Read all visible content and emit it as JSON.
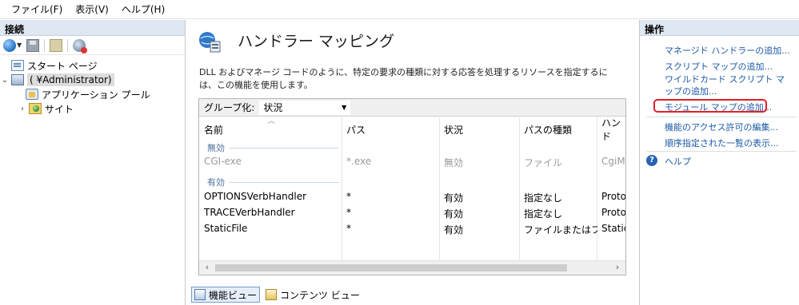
{
  "menu": [
    "ファイル(F)",
    "表示(V)",
    "ヘルプ(H)"
  ],
  "connections": {
    "title": "接続",
    "tree": [
      {
        "label": "スタート ページ"
      },
      {
        "label": "(        ¥Administrator)"
      },
      {
        "label": "アプリケーション プール"
      },
      {
        "label": "サイト"
      }
    ]
  },
  "center": {
    "title": "ハンドラー マッピング",
    "description": "DLL およびマネージ コードのように、特定の要求の種類に対する応答を処理するリソースを指定するには、この機能を使用します。",
    "group_label": "グループ化:",
    "group_value": "状況",
    "columns": [
      "名前",
      "パス",
      "状況",
      "パスの種類",
      "ハンド"
    ],
    "groups": [
      {
        "label": "無効",
        "rows": [
          [
            "CGI-exe",
            "*.exe",
            "無効",
            "ファイル",
            "CgiM"
          ]
        ]
      },
      {
        "label": "有効",
        "rows": [
          [
            "OPTIONSVerbHandler",
            "*",
            "有効",
            "指定なし",
            "Proto"
          ],
          [
            "TRACEVerbHandler",
            "*",
            "有効",
            "指定なし",
            "Proto"
          ],
          [
            "StaticFile",
            "*",
            "有効",
            "ファイルまたはフ...",
            "Static"
          ]
        ]
      }
    ],
    "view_tabs": [
      "機能ビュー",
      "コンテンツ ビュー"
    ]
  },
  "actions": {
    "title": "操作",
    "items": [
      "マネージド ハンドラーの追加...",
      "スクリプト マップの追加...",
      "ワイルドカード スクリプト マップの追加...",
      "モジュール マップの追加...",
      "機能のアクセス許可の編集...",
      "順序指定された一覧の表示...",
      "ヘルプ"
    ],
    "highlight_color": "#e0202a"
  }
}
